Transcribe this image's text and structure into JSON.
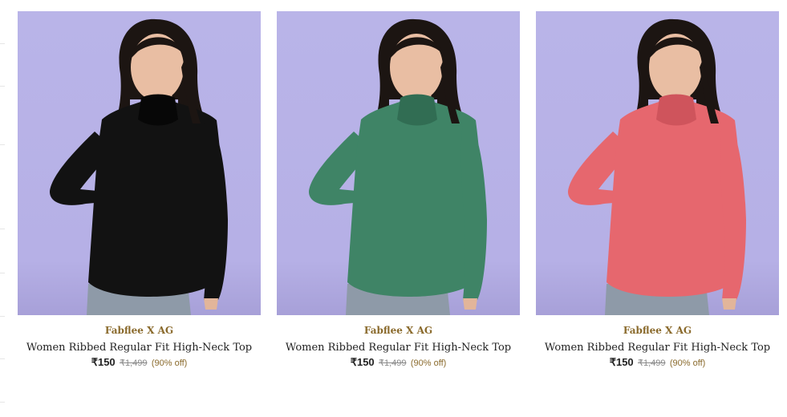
{
  "products": [
    {
      "brand": "Fabflee X AG",
      "title": "Women Ribbed Regular Fit High-Neck Top",
      "price": "₹150",
      "mrp": "₹1,499",
      "discount": "(90% off)",
      "garment_color": "#121212",
      "garment_shade": "#070707"
    },
    {
      "brand": "Fabflee X AG",
      "title": "Women Ribbed Regular Fit High-Neck Top",
      "price": "₹150",
      "mrp": "₹1,499",
      "discount": "(90% off)",
      "garment_color": "#3f8466",
      "garment_shade": "#316d53"
    },
    {
      "brand": "Fabflee X AG",
      "title": "Women Ribbed Regular Fit High-Neck Top",
      "price": "₹150",
      "mrp": "₹1,499",
      "discount": "(90% off)",
      "garment_color": "#e6676e",
      "garment_shade": "#cf545c"
    }
  ],
  "colors": {
    "image_background": "#b9b4e8",
    "brand_text": "#8a6a2c",
    "discount_text": "#8a6a2c"
  }
}
